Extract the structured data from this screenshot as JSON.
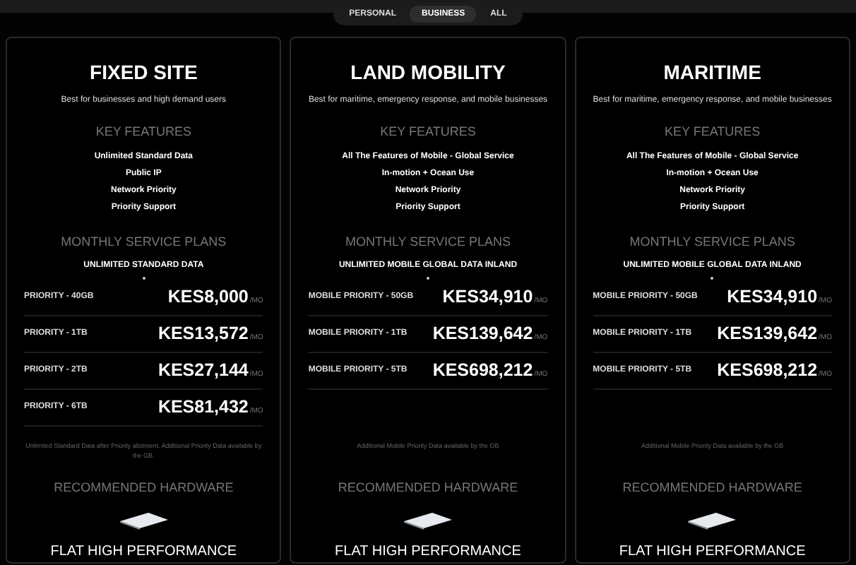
{
  "tabs": [
    {
      "label": "PERSONAL",
      "selected": false
    },
    {
      "label": "BUSINESS",
      "selected": true
    },
    {
      "label": "ALL",
      "selected": false
    }
  ],
  "plans": [
    {
      "title": "FIXED SITE",
      "subtitle": "Best for businesses and high demand users",
      "features_heading": "KEY FEATURES",
      "features": [
        "Unlimited Standard Data",
        "Public IP",
        "Network Priority",
        "Priority Support"
      ],
      "plans_heading": "MONTHLY SERVICE PLANS",
      "data_label": "UNLIMITED STANDARD DATA",
      "rows": [
        {
          "name": "PRIORITY - 40GB",
          "price": "KES8,000",
          "unit": "/MO"
        },
        {
          "name": "PRIORITY - 1TB",
          "price": "KES13,572",
          "unit": "/MO"
        },
        {
          "name": "PRIORITY - 2TB",
          "price": "KES27,144",
          "unit": "/MO"
        },
        {
          "name": "PRIORITY - 6TB",
          "price": "KES81,432",
          "unit": "/MO"
        }
      ],
      "note": "Unlimited Standard Data after Priority allotment. Additional Priority Data available by the GB.",
      "hardware_heading": "RECOMMENDED HARDWARE",
      "hardware_name": "FLAT HIGH PERFORMANCE"
    },
    {
      "title": "LAND MOBILITY",
      "subtitle": "Best for maritime, emergency response, and mobile businesses",
      "features_heading": "KEY FEATURES",
      "features": [
        "All The Features of Mobile - Global Service",
        "In-motion + Ocean Use",
        "Network Priority",
        "Priority Support"
      ],
      "plans_heading": "MONTHLY SERVICE PLANS",
      "data_label": "UNLIMITED MOBILE GLOBAL DATA INLAND",
      "rows": [
        {
          "name": "MOBILE PRIORITY - 50GB",
          "price": "KES34,910",
          "unit": "/MO"
        },
        {
          "name": "MOBILE PRIORITY - 1TB",
          "price": "KES139,642",
          "unit": "/MO"
        },
        {
          "name": "MOBILE PRIORITY - 5TB",
          "price": "KES698,212",
          "unit": "/MO"
        }
      ],
      "note": "Additional Mobile Priority Data available by the GB",
      "hardware_heading": "RECOMMENDED HARDWARE",
      "hardware_name": "FLAT HIGH PERFORMANCE"
    },
    {
      "title": "MARITIME",
      "subtitle": "Best for maritime, emergency response, and mobile businesses",
      "features_heading": "KEY FEATURES",
      "features": [
        "All The Features of Mobile - Global Service",
        "In-motion + Ocean Use",
        "Network Priority",
        "Priority Support"
      ],
      "plans_heading": "MONTHLY SERVICE PLANS",
      "data_label": "UNLIMITED MOBILE GLOBAL DATA INLAND",
      "rows": [
        {
          "name": "MOBILE PRIORITY - 50GB",
          "price": "KES34,910",
          "unit": "/MO"
        },
        {
          "name": "MOBILE PRIORITY - 1TB",
          "price": "KES139,642",
          "unit": "/MO"
        },
        {
          "name": "MOBILE PRIORITY - 5TB",
          "price": "KES698,212",
          "unit": "/MO"
        }
      ],
      "note": "Additional Mobile Priority Data available by the GB",
      "hardware_heading": "RECOMMENDED HARDWARE",
      "hardware_name": "FLAT HIGH PERFORMANCE"
    }
  ]
}
